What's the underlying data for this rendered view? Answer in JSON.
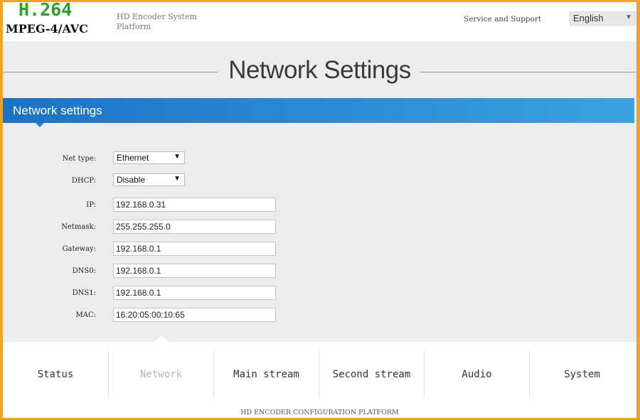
{
  "header": {
    "logo_top": "H.264",
    "logo_bottom": "MPEG-4/AVC",
    "platform_title": "HD Encoder System Platform",
    "service_link": "Service and Support",
    "language": "English"
  },
  "page_title": "Network Settings",
  "section_title": "Network settings",
  "form": {
    "net_type": {
      "label": "Net type:",
      "value": "Ethernet"
    },
    "dhcp": {
      "label": "DHCP:",
      "value": "Disable"
    },
    "ip": {
      "label": "IP:",
      "value": "192.168.0.31"
    },
    "netmask": {
      "label": "Netmask:",
      "value": "255.255.255.0"
    },
    "gateway": {
      "label": "Gateway:",
      "value": "192.168.0.1"
    },
    "dns0": {
      "label": "DNS0:",
      "value": "192.168.0.1"
    },
    "dns1": {
      "label": "DNS1:",
      "value": "192.168.0.1"
    },
    "mac": {
      "label": "MAC:",
      "value": "16:20:05:00:10:65"
    }
  },
  "nav": {
    "tabs": [
      {
        "label": "Status"
      },
      {
        "label": "Network"
      },
      {
        "label": "Main stream"
      },
      {
        "label": "Second stream"
      },
      {
        "label": "Audio"
      },
      {
        "label": "System"
      }
    ]
  },
  "footer": "HD ENCODER CONFIGURATION PLATFORM",
  "colors": {
    "frame_border": "#f2a41c",
    "section_bar_start": "#1c72c6",
    "section_bar_end": "#3aa2de",
    "logo_green": "#2aa12a"
  }
}
